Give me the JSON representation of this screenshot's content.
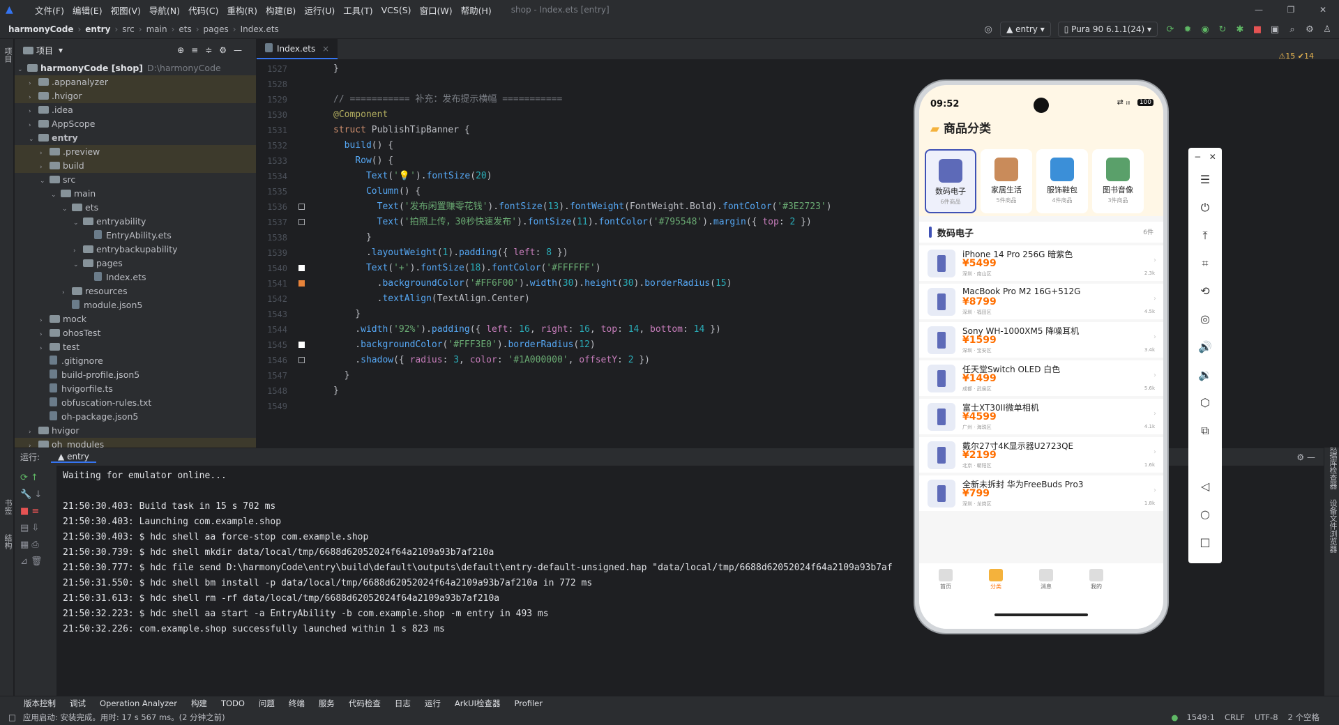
{
  "menubar": {
    "items": [
      "文件(F)",
      "编辑(E)",
      "视图(V)",
      "导航(N)",
      "代码(C)",
      "重构(R)",
      "构建(B)",
      "运行(U)",
      "工具(T)",
      "VCS(S)",
      "窗口(W)",
      "帮助(H)"
    ],
    "title": "shop - Index.ets [entry]"
  },
  "breadcrumb": [
    "harmonyCode",
    "entry",
    "src",
    "main",
    "ets",
    "pages",
    "Index.ets"
  ],
  "toolbar": {
    "run_config": "entry",
    "device": "Pura 90 6.1.1(24)"
  },
  "project": {
    "title": "项目",
    "root": "harmonyCode [shop]",
    "root_path": "D:\\harmonyCode",
    "tree": [
      {
        "label": ".appanalyzer",
        "depth": 1,
        "arrow": "›",
        "type": "folder",
        "hl": "ex"
      },
      {
        "label": ".hvigor",
        "depth": 1,
        "arrow": "›",
        "type": "folder",
        "hl": "ex"
      },
      {
        "label": ".idea",
        "depth": 1,
        "arrow": "›",
        "type": "folder",
        "hl": ""
      },
      {
        "label": "AppScope",
        "depth": 1,
        "arrow": "›",
        "type": "folder",
        "hl": ""
      },
      {
        "label": "entry",
        "depth": 1,
        "arrow": "⌄",
        "type": "folder",
        "hl": "",
        "bold": true
      },
      {
        "label": ".preview",
        "depth": 2,
        "arrow": "›",
        "type": "folder",
        "hl": "ex"
      },
      {
        "label": "build",
        "depth": 2,
        "arrow": "›",
        "type": "folder",
        "hl": "ex"
      },
      {
        "label": "src",
        "depth": 2,
        "arrow": "⌄",
        "type": "folder",
        "hl": ""
      },
      {
        "label": "main",
        "depth": 3,
        "arrow": "⌄",
        "type": "folder",
        "hl": ""
      },
      {
        "label": "ets",
        "depth": 4,
        "arrow": "⌄",
        "type": "folder",
        "hl": ""
      },
      {
        "label": "entryability",
        "depth": 5,
        "arrow": "⌄",
        "type": "folder",
        "hl": ""
      },
      {
        "label": "EntryAbility.ets",
        "depth": 6,
        "arrow": "",
        "type": "file",
        "hl": ""
      },
      {
        "label": "entrybackupability",
        "depth": 5,
        "arrow": "›",
        "type": "folder",
        "hl": ""
      },
      {
        "label": "pages",
        "depth": 5,
        "arrow": "⌄",
        "type": "folder",
        "hl": ""
      },
      {
        "label": "Index.ets",
        "depth": 6,
        "arrow": "",
        "type": "file",
        "hl": ""
      },
      {
        "label": "resources",
        "depth": 4,
        "arrow": "›",
        "type": "folder",
        "hl": ""
      },
      {
        "label": "module.json5",
        "depth": 4,
        "arrow": "",
        "type": "file",
        "hl": ""
      },
      {
        "label": "mock",
        "depth": 2,
        "arrow": "›",
        "type": "folder",
        "hl": ""
      },
      {
        "label": "ohosTest",
        "depth": 2,
        "arrow": "›",
        "type": "folder",
        "hl": ""
      },
      {
        "label": "test",
        "depth": 2,
        "arrow": "›",
        "type": "folder",
        "hl": ""
      },
      {
        "label": ".gitignore",
        "depth": 2,
        "arrow": "",
        "type": "file",
        "hl": ""
      },
      {
        "label": "build-profile.json5",
        "depth": 2,
        "arrow": "",
        "type": "file",
        "hl": ""
      },
      {
        "label": "hvigorfile.ts",
        "depth": 2,
        "arrow": "",
        "type": "file",
        "hl": ""
      },
      {
        "label": "obfuscation-rules.txt",
        "depth": 2,
        "arrow": "",
        "type": "file",
        "hl": ""
      },
      {
        "label": "oh-package.json5",
        "depth": 2,
        "arrow": "",
        "type": "file",
        "hl": ""
      },
      {
        "label": "hvigor",
        "depth": 1,
        "arrow": "›",
        "type": "folder",
        "hl": ""
      },
      {
        "label": "oh_modules",
        "depth": 1,
        "arrow": "›",
        "type": "folder",
        "hl": "ex"
      }
    ]
  },
  "editor": {
    "tab": "Index.ets",
    "inspection": "⚠15 ✔14",
    "lines": [
      {
        "n": "1527",
        "h": "<span>}</span>",
        "m": ""
      },
      {
        "n": "1528",
        "h": "",
        "m": ""
      },
      {
        "n": "1529",
        "h": "<span class='cm'>// =========== 补充：发布提示横幅 ===========</span>",
        "m": ""
      },
      {
        "n": "1530",
        "h": "<span class='an'>@Component</span>",
        "m": ""
      },
      {
        "n": "1531",
        "h": "<span class='kw'>struct</span> PublishTipBanner {",
        "m": ""
      },
      {
        "n": "1532",
        "h": "  <span class='fn'>build</span>() {",
        "m": ""
      },
      {
        "n": "1533",
        "h": "    <span class='fn'>Row</span>() {",
        "m": ""
      },
      {
        "n": "1534",
        "h": "      <span class='fn'>Text</span>(<span class='str'>'💡'</span>).<span class='fn'>fontSize</span>(<span class='num'>20</span>)",
        "m": ""
      },
      {
        "n": "1535",
        "h": "      <span class='fn'>Column</span>() {",
        "m": ""
      },
      {
        "n": "1536",
        "h": "        <span class='fn'>Text</span>(<span class='str'>'发布闲置赚零花钱'</span>).<span class='fn'>fontSize</span>(<span class='num'>13</span>).<span class='fn'>fontWeight</span>(FontWeight.Bold).<span class='fn'>fontColor</span>(<span class='str'>'#3E2723'</span>)",
        "m": "d"
      },
      {
        "n": "1537",
        "h": "        <span class='fn'>Text</span>(<span class='str'>'拍照上传，30秒快速发布'</span>).<span class='fn'>fontSize</span>(<span class='num'>11</span>).<span class='fn'>fontColor</span>(<span class='str'>'#795548'</span>).<span class='fn'>margin</span>({ <span class='pr'>top</span>: <span class='num'>2</span> })",
        "m": "b"
      },
      {
        "n": "1538",
        "h": "      }",
        "m": ""
      },
      {
        "n": "1539",
        "h": "      .<span class='fn'>layoutWeight</span>(<span class='num'>1</span>).<span class='fn'>padding</span>({ <span class='pr'>left</span>: <span class='num'>8</span> })",
        "m": ""
      },
      {
        "n": "1540",
        "h": "      <span class='fn'>Text</span>(<span class='str'>'+'</span>).<span class='fn'>fontSize</span>(<span class='num'>18</span>).<span class='fn'>fontColor</span>(<span class='str'>'#FFFFFF'</span>)",
        "m": "w"
      },
      {
        "n": "1541",
        "h": "        .<span class='fn'>backgroundColor</span>(<span class='str'>'#FF6F00'</span>).<span class='fn'>width</span>(<span class='num'>30</span>).<span class='fn'>height</span>(<span class='num'>30</span>).<span class='fn'>borderRadius</span>(<span class='num'>15</span>)",
        "m": "o"
      },
      {
        "n": "1542",
        "h": "        .<span class='fn'>textAlign</span>(TextAlign.Center)",
        "m": ""
      },
      {
        "n": "1543",
        "h": "    }",
        "m": ""
      },
      {
        "n": "1544",
        "h": "    .<span class='fn'>width</span>(<span class='str'>'92%'</span>).<span class='fn'>padding</span>({ <span class='pr'>left</span>: <span class='num'>16</span>, <span class='pr'>right</span>: <span class='num'>16</span>, <span class='pr'>top</span>: <span class='num'>14</span>, <span class='pr'>bottom</span>: <span class='num'>14</span> })",
        "m": ""
      },
      {
        "n": "1545",
        "h": "    .<span class='fn'>backgroundColor</span>(<span class='str'>'#FFF3E0'</span>).<span class='fn'>borderRadius</span>(<span class='num'>12</span>)",
        "m": "w"
      },
      {
        "n": "1546",
        "h": "    .<span class='fn'>shadow</span>({ <span class='pr'>radius</span>: <span class='num'>3</span>, <span class='pr'>color</span>: <span class='str'>'#1A000000'</span>, <span class='pr'>offsetY</span>: <span class='num'>2</span> })",
        "m": "d"
      },
      {
        "n": "1547",
        "h": "  }",
        "m": ""
      },
      {
        "n": "1548",
        "h": "}",
        "m": ""
      },
      {
        "n": "1549",
        "h": "",
        "m": ""
      }
    ]
  },
  "run": {
    "label": "运行:",
    "tab": "entry",
    "lines": [
      "Waiting for emulator online...",
      "",
      "21:50:30.403: Build task in 15 s 702 ms",
      "21:50:30.403: Launching com.example.shop",
      "21:50:30.403: $ hdc shell aa force-stop com.example.shop",
      "21:50:30.739: $ hdc shell mkdir data/local/tmp/6688d62052024f64a2109a93b7af210a",
      "21:50:30.777: $ hdc file send D:\\harmonyCode\\entry\\build\\default\\outputs\\default\\entry-default-unsigned.hap \"data/local/tmp/6688d62052024f64a2109a93b7af",
      "21:50:31.550: $ hdc shell bm install -p data/local/tmp/6688d62052024f64a2109a93b7af210a in 772 ms",
      "21:50:31.613: $ hdc shell rm -rf data/local/tmp/6688d62052024f64a2109a93b7af210a",
      "21:50:32.223: $ hdc shell aa start -a EntryAbility -b com.example.shop -m entry in 493 ms",
      "21:50:32.226: com.example.shop successfully launched within 1 s 823 ms"
    ]
  },
  "bottom_tools": [
    "版本控制",
    "调试",
    "Operation Analyzer",
    "构建",
    "TODO",
    "问题",
    "终端",
    "服务",
    "代码检查",
    "日志",
    "运行",
    "ArkUI检查器",
    "Profiler"
  ],
  "status": {
    "message": "应用启动: 安装完成。用时: 17 s 567 ms。(2 分钟之前)",
    "position": "1549:1",
    "line_sep": "CRLF",
    "encoding": "UTF-8",
    "indent": "2 个空格"
  },
  "left_strip": [
    "项目",
    "书签",
    "结构"
  ],
  "right_strip": [
    "CodeGenie",
    "通知",
    "AppAnalyzer",
    "预览器",
    "Hvigor",
    "Application Agent",
    "数据库检查器",
    "设备文件浏览器"
  ],
  "phone": {
    "time": "09:52",
    "status": "100",
    "header": "商品分类",
    "categories": [
      {
        "name": "数码电子",
        "count": "6件商品",
        "color": "#5d6ab8"
      },
      {
        "name": "家居生活",
        "count": "5件商品",
        "color": "#c98b5a"
      },
      {
        "name": "服饰鞋包",
        "count": "4件商品",
        "color": "#3b8fd8"
      },
      {
        "name": "图书音像",
        "count": "3件商品",
        "color": "#5aa06a"
      }
    ],
    "section": "数码电子",
    "section_count": "6件",
    "products": [
      {
        "name": "iPhone 14 Pro 256G 暗紫色",
        "price": "¥5499",
        "loc": "深圳 · 南山区",
        "views": "2.3k"
      },
      {
        "name": "MacBook Pro M2 16G+512G",
        "price": "¥8799",
        "loc": "深圳 · 福田区",
        "views": "4.5k"
      },
      {
        "name": "Sony WH-1000XM5 降噪耳机",
        "price": "¥1599",
        "loc": "深圳 · 宝安区",
        "views": "3.4k"
      },
      {
        "name": "任天堂Switch OLED 白色",
        "price": "¥1499",
        "loc": "成都 · 武侯区",
        "views": "5.6k"
      },
      {
        "name": "富士XT30II微单相机",
        "price": "¥4599",
        "loc": "广州 · 海珠区",
        "views": "4.1k"
      },
      {
        "name": "戴尔27寸4K显示器U2723QE",
        "price": "¥2199",
        "loc": "北京 · 朝阳区",
        "views": "1.6k"
      },
      {
        "name": "全新未拆封 华为FreeBuds Pro3",
        "price": "¥799",
        "loc": "深圳 · 龙岗区",
        "views": "1.8k"
      }
    ],
    "nav": [
      "首页",
      "分类",
      "消息",
      "我的"
    ],
    "accent": "#ff6f00"
  }
}
